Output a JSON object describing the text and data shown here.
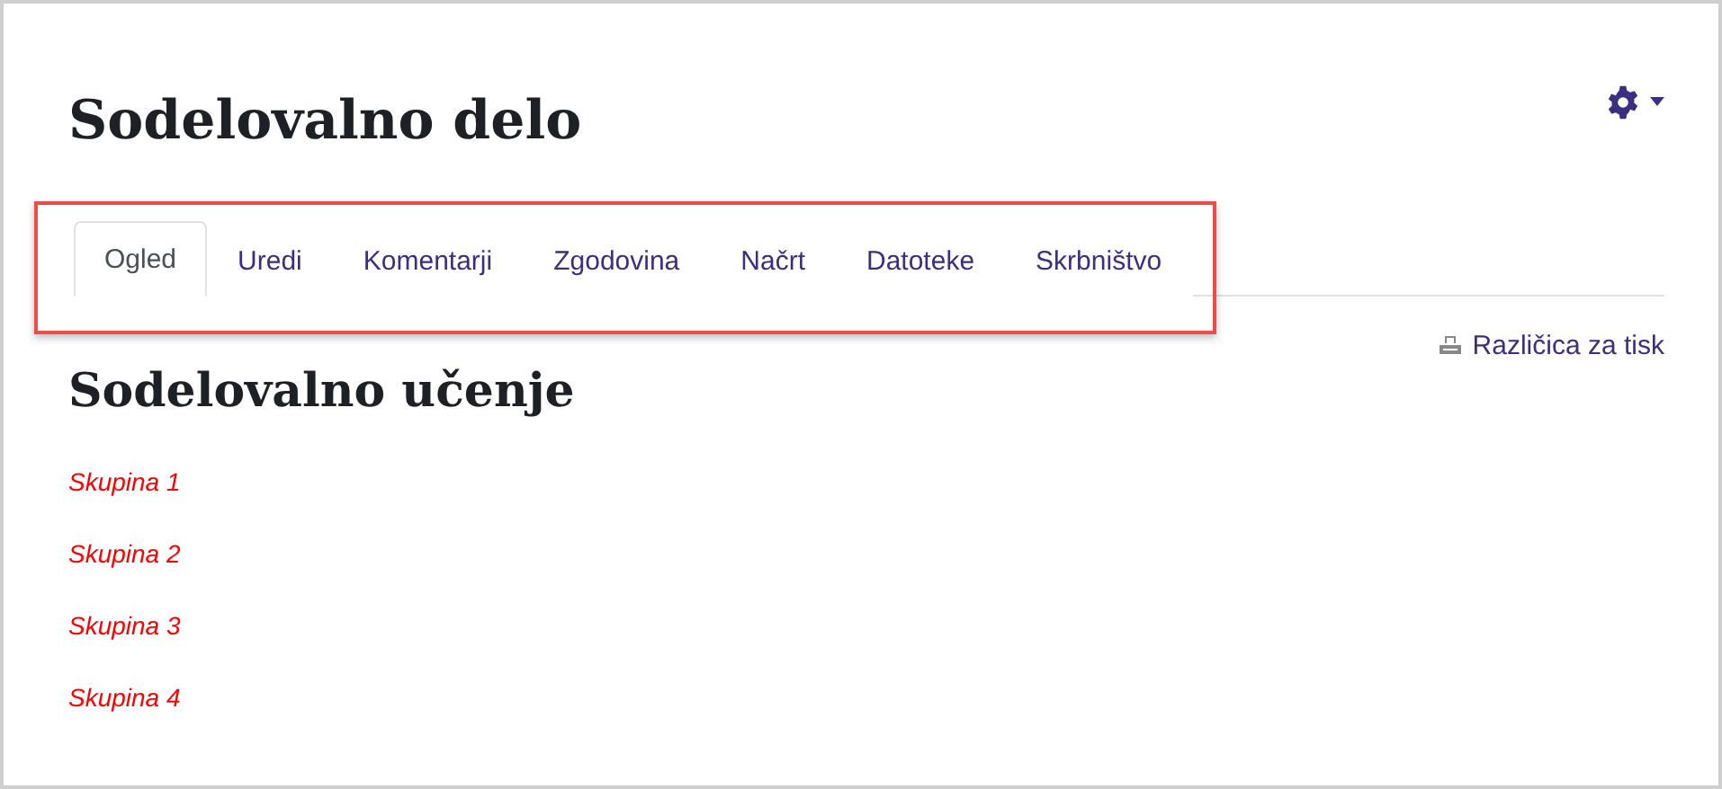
{
  "page_title": "Sodelovalno delo",
  "settings_menu": {
    "expanded": false
  },
  "tabs": [
    {
      "label": "Ogled",
      "selected": true
    },
    {
      "label": "Uredi",
      "selected": false
    },
    {
      "label": "Komentarji",
      "selected": false
    },
    {
      "label": "Zgodovina",
      "selected": false
    },
    {
      "label": "Načrt",
      "selected": false
    },
    {
      "label": "Datoteke",
      "selected": false
    },
    {
      "label": "Skrbništvo",
      "selected": false
    }
  ],
  "print_link": "Različica za tisk",
  "heading": "Sodelovalno učenje",
  "links": [
    "Skupina 1",
    "Skupina 2",
    "Skupina 3",
    "Skupina 4"
  ]
}
